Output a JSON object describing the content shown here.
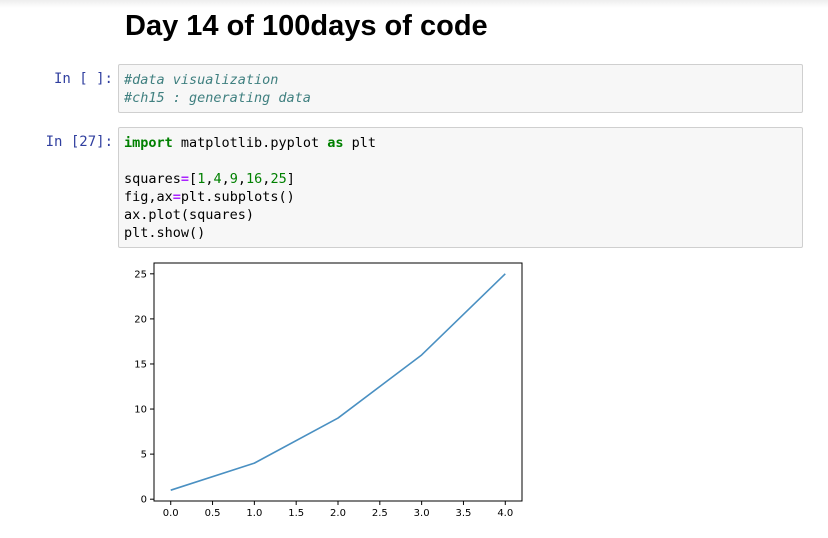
{
  "notebook": {
    "title": "Day 14 of 100days of code"
  },
  "cells": [
    {
      "prompt": "In [ ]:",
      "lines": [
        "#data visualization",
        "#ch15 : generating data"
      ]
    },
    {
      "prompt": "In [27]:",
      "lines": [
        "import matplotlib.pyplot as plt",
        "",
        "squares=[1,4,9,16,25]",
        "fig,ax=plt.subplots()",
        "ax.plot(squares)",
        "plt.show()"
      ],
      "tokens": {
        "import_kw": "import",
        "module": " matplotlib.pyplot ",
        "as_kw": "as",
        "alias": " plt",
        "squares_var": "squares",
        "eq": "=",
        "list_open": "[",
        "nums": [
          "1",
          "4",
          "9",
          "16",
          "25"
        ],
        "comma": ",",
        "list_close": "]",
        "fig_var": "fig,ax",
        "subplots_call": "plt.subplots()",
        "plot_call": "ax.plot(squares)",
        "show_call": "plt.show()"
      }
    }
  ],
  "colors": {
    "line": "#4a90c2",
    "prompt": "#303f9f",
    "comment": "#408080",
    "keyword": "#008000"
  },
  "chart_data": {
    "type": "line",
    "x": [
      0,
      1,
      2,
      3,
      4
    ],
    "series": [
      {
        "values": [
          1,
          4,
          9,
          16,
          25
        ]
      }
    ],
    "xlim": [
      -0.2,
      4.2
    ],
    "ylim": [
      -0.2,
      26.2
    ],
    "xticks": [
      "0.0",
      "0.5",
      "1.0",
      "1.5",
      "2.0",
      "2.5",
      "3.0",
      "3.5",
      "4.0"
    ],
    "xtick_values": [
      0,
      0.5,
      1,
      1.5,
      2,
      2.5,
      3,
      3.5,
      4
    ],
    "yticks": [
      "0",
      "5",
      "10",
      "15",
      "20",
      "25"
    ],
    "ytick_values": [
      0,
      5,
      10,
      15,
      20,
      25
    ],
    "grid": false
  }
}
